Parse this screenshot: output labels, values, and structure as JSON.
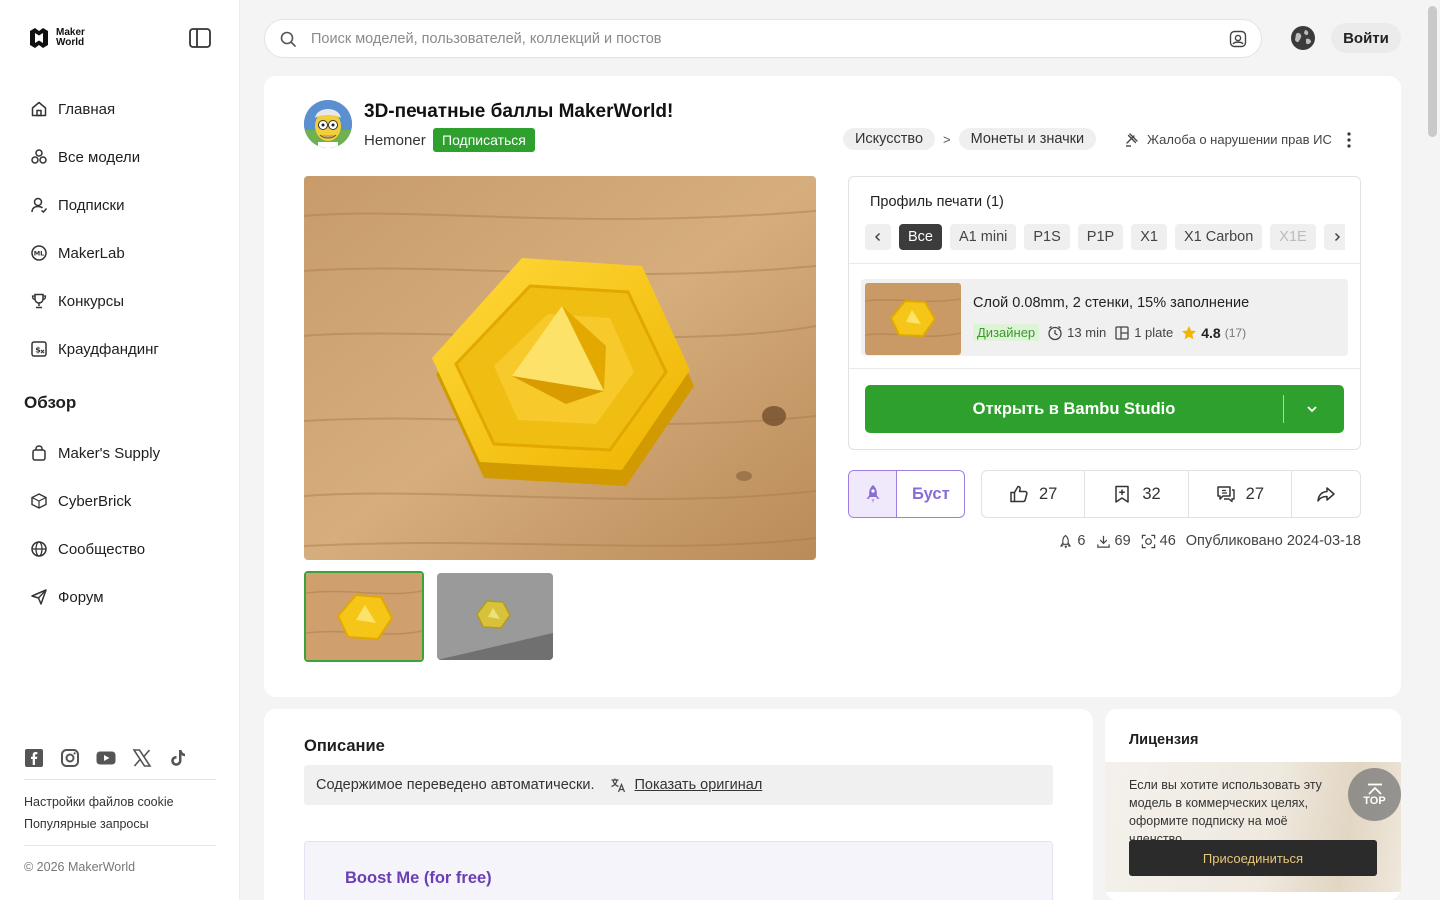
{
  "app": {
    "logo_line1": "Maker",
    "logo_line2": "World"
  },
  "sidebar": {
    "items": [
      {
        "label": "Главная",
        "icon": "home-icon"
      },
      {
        "label": "Все модели",
        "icon": "models-icon"
      },
      {
        "label": "Подписки",
        "icon": "user-follow-icon"
      },
      {
        "label": "MakerLab",
        "icon": "makerlab-icon"
      },
      {
        "label": "Конкурсы",
        "icon": "trophy-icon"
      },
      {
        "label": "Краудфандинг",
        "icon": "crowdfunding-icon"
      }
    ],
    "section_heading": "Обзор",
    "items2": [
      {
        "label": "Maker's Supply",
        "icon": "bag-icon"
      },
      {
        "label": "CyberBrick",
        "icon": "cyberbrick-icon"
      },
      {
        "label": "Сообщество",
        "icon": "globe-icon"
      },
      {
        "label": "Форум",
        "icon": "send-icon"
      }
    ],
    "footer": {
      "cookie_settings": "Настройки файлов cookie",
      "popular_queries": "Популярные запросы",
      "copyright": "© 2026 MakerWorld"
    }
  },
  "header": {
    "search_placeholder": "Поиск моделей, пользователей, коллекций и постов",
    "login_label": "Войти"
  },
  "model": {
    "title": "3D-печатные баллы MakerWorld!",
    "author": "Hemoner",
    "subscribe_label": "Подписаться",
    "breadcrumbs": [
      "Искусство",
      "Монеты и значки"
    ],
    "breadcrumb_sep": ">",
    "report_label": "Жалоба о нарушении прав ИС"
  },
  "print_profile": {
    "title": "Профиль печати (1)",
    "filters": [
      "Все",
      "A1 mini",
      "P1S",
      "P1P",
      "X1",
      "X1 Carbon",
      "X1E"
    ],
    "item": {
      "title": "Слой 0.08mm, 2 стенки, 15% заполнение",
      "tag": "Дизайнер",
      "time": "13 min",
      "plates": "1 plate",
      "rating": "4.8",
      "rating_count": "(17)"
    },
    "open_label": "Открыть в Bambu Studio"
  },
  "actions": {
    "boost_label": "Буст",
    "likes": "27",
    "collects": "32",
    "comments": "27"
  },
  "counts": {
    "boosts": "6",
    "downloads": "69",
    "prints": "46",
    "published": "Опубликовано 2024-03-18"
  },
  "description": {
    "title": "Описание",
    "translated_note": "Содержимое переведено автоматически.",
    "show_original": "Показать оригинал",
    "boost_heading": "Boost Me (for free)"
  },
  "license": {
    "title": "Лицензия",
    "text": "Если вы хотите использовать эту модель в коммерческих целях, оформите подписку на моё членство.",
    "join_label": "Присоединиться"
  },
  "top_button_label": "TOP",
  "colors": {
    "accent_green": "#2ea02e",
    "boost_purple": "#8a6cd6",
    "coin_yellow": "#f5c518",
    "wood": "#c9a070"
  }
}
